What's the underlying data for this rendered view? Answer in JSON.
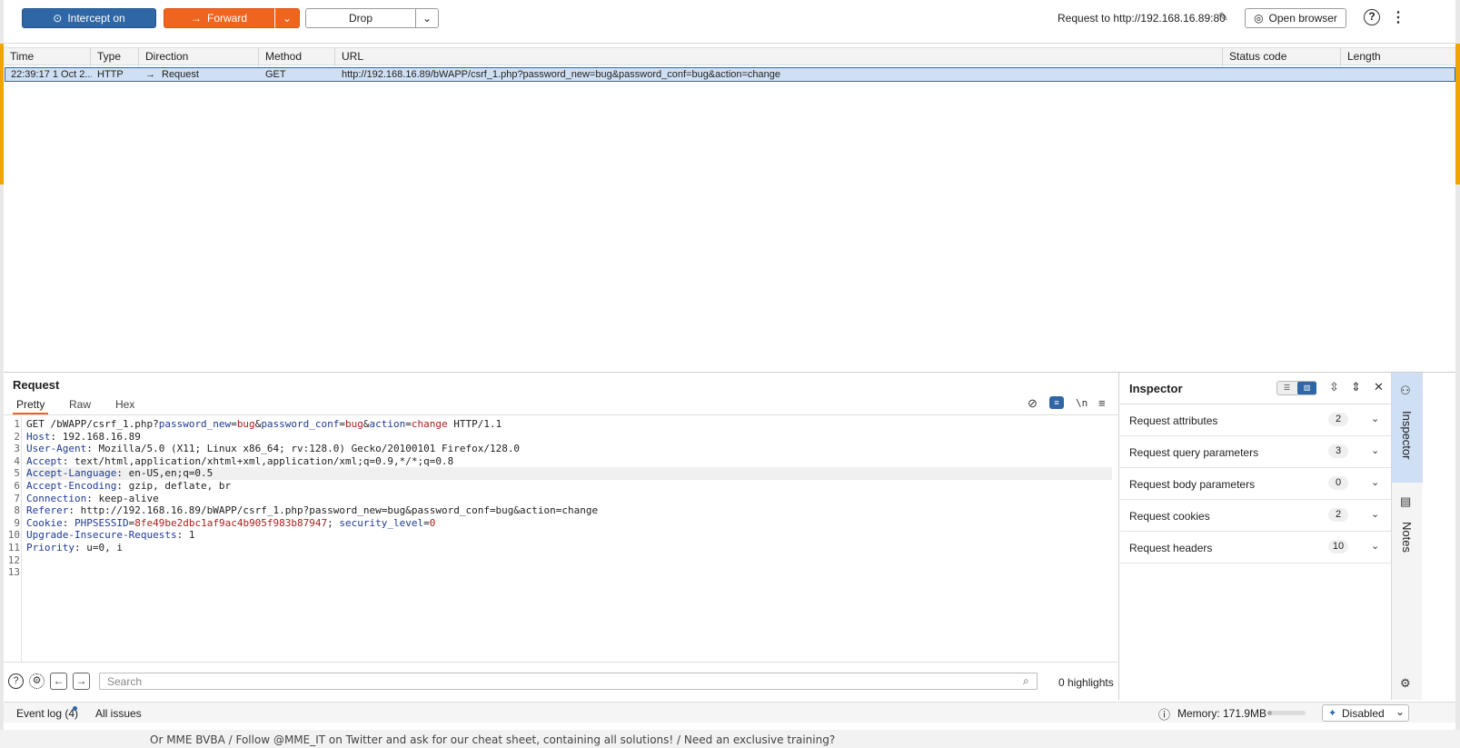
{
  "toolbar": {
    "intercept_label": "Intercept on",
    "forward_label": "Forward",
    "drop_label": "Drop",
    "request_to": "Request to http://192.168.16.89:80",
    "open_browser_label": "Open browser"
  },
  "table": {
    "columns": [
      "Time",
      "Type",
      "Direction",
      "Method",
      "URL",
      "Status code",
      "Length"
    ],
    "rows": [
      {
        "time": "22:39:17 1 Oct 2...",
        "type": "HTTP",
        "direction_arrow": "→",
        "direction": "Request",
        "method": "GET",
        "url": "http://192.168.16.89/bWAPP/csrf_1.php?password_new=bug&password_conf=bug&action=change",
        "status_code": "",
        "length": ""
      }
    ]
  },
  "request": {
    "title": "Request",
    "tabs": [
      "Pretty",
      "Raw",
      "Hex"
    ],
    "active_tab": "Pretty",
    "newline_label": "\\n",
    "lines": {
      "l1": {
        "method": "GET /bWAPP/csrf_1.php?",
        "p1k": "password_new",
        "p1v": "bug",
        "p2k": "password_conf",
        "p2v": "bug",
        "p3k": "action",
        "p3v": "change",
        "tail": " HTTP/1.1"
      },
      "l2": {
        "name": "Host",
        "value": ": 192.168.16.89"
      },
      "l3": {
        "name": "User-Agent",
        "value": ": Mozilla/5.0 (X11; Linux x86_64; rv:128.0) Gecko/20100101 Firefox/128.0"
      },
      "l4": {
        "name": "Accept",
        "value": ": text/html,application/xhtml+xml,application/xml;q=0.9,*/*;q=0.8"
      },
      "l5": {
        "name": "Accept-Language",
        "value": ": en-US,en;q=0.5"
      },
      "l6": {
        "name": "Accept-Encoding",
        "value": ": gzip, deflate, br"
      },
      "l7": {
        "name": "Connection",
        "value": ": keep-alive"
      },
      "l8": {
        "name": "Referer",
        "value": ": http://192.168.16.89/bWAPP/csrf_1.php?password_new=bug&password_conf=bug&action=change"
      },
      "l9": {
        "name": "Cookie",
        "c1k": "PHPSESSID",
        "c1v": "8fe49be2dbc1af9ac4b905f983b87947",
        "c2k": "security_level",
        "c2v": "0"
      },
      "l10": {
        "name": "Upgrade-Insecure-Requests",
        "value": ": 1"
      },
      "l11": {
        "name": "Priority",
        "value": ": u=0, i"
      }
    },
    "line_numbers": [
      "1",
      "2",
      "3",
      "4",
      "5",
      "6",
      "7",
      "8",
      "9",
      "10",
      "11",
      "12",
      "13"
    ]
  },
  "search": {
    "placeholder": "Search",
    "highlights": "0 highlights"
  },
  "inspector": {
    "title": "Inspector",
    "sections": [
      {
        "label": "Request attributes",
        "count": "2"
      },
      {
        "label": "Request query parameters",
        "count": "3"
      },
      {
        "label": "Request body parameters",
        "count": "0"
      },
      {
        "label": "Request cookies",
        "count": "2"
      },
      {
        "label": "Request headers",
        "count": "10"
      }
    ]
  },
  "side_rail": {
    "inspector_label": "Inspector",
    "notes_label": "Notes"
  },
  "status_bar": {
    "event_log": "Event log (4)",
    "all_issues": "All issues",
    "memory": "Memory: 171.9MB",
    "ai_status": "Disabled"
  },
  "background": {
    "footer_text": "Or MME BVBA / Follow @MME_IT on Twitter and ask for our cheat sheet, containing all solutions! / Need an exclusive training?"
  },
  "colors": {
    "accent_blue": "#2f67a6",
    "forward_orange": "#f0651e",
    "selected_row": "#cfe0f5"
  }
}
